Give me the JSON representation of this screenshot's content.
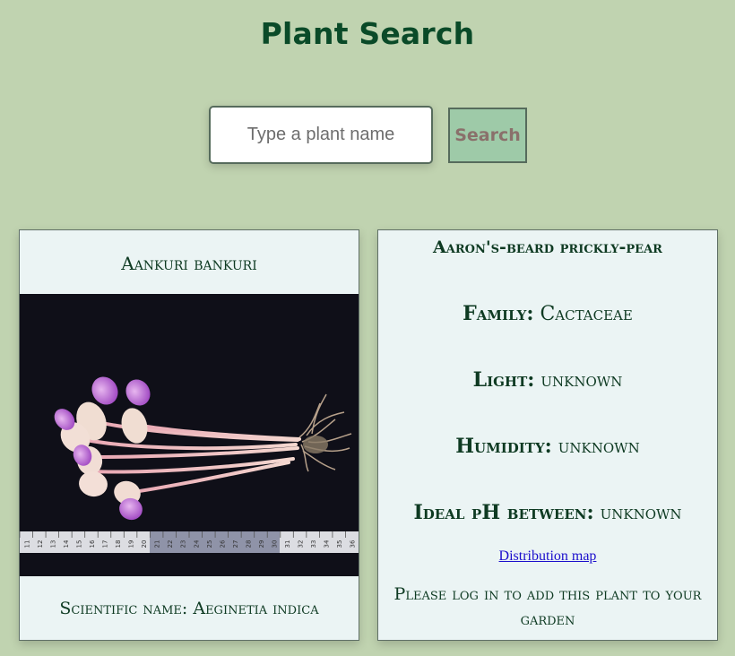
{
  "header": {
    "title": "Plant Search"
  },
  "search": {
    "placeholder": "Type a plant name",
    "value": "",
    "button_label": "Search"
  },
  "result_card": {
    "common_name": "Aankuri bankuri",
    "scientific_label": "Scientific name:",
    "scientific_name": "Aeginetia indica"
  },
  "detail_card": {
    "title": "Aaron's-beard prickly-pear",
    "family_label": "Family:",
    "family_value": "Cactaceae",
    "light_label": "Light:",
    "light_value": "unknown",
    "humidity_label": "Humidity:",
    "humidity_value": "unknown",
    "ph_label": "Ideal pH between:",
    "ph_value": "unknown",
    "distribution_link": "Distribution map",
    "login_message": "Please log in to add this plant to your garden"
  },
  "photo": {
    "tape_marks": [
      "11",
      "12",
      "13",
      "14",
      "15",
      "16",
      "17",
      "18",
      "19",
      "20",
      "21",
      "22",
      "23",
      "24",
      "25",
      "26",
      "27",
      "28",
      "29",
      "30",
      "31",
      "32",
      "33",
      "34",
      "35",
      "36"
    ]
  },
  "colors": {
    "background": "#c0d3b0",
    "title": "#0a4a28",
    "card_bg": "#ebf4f4",
    "button_bg": "#9ecaa8",
    "button_text": "#8a706b",
    "link": "#1a0dcc"
  }
}
